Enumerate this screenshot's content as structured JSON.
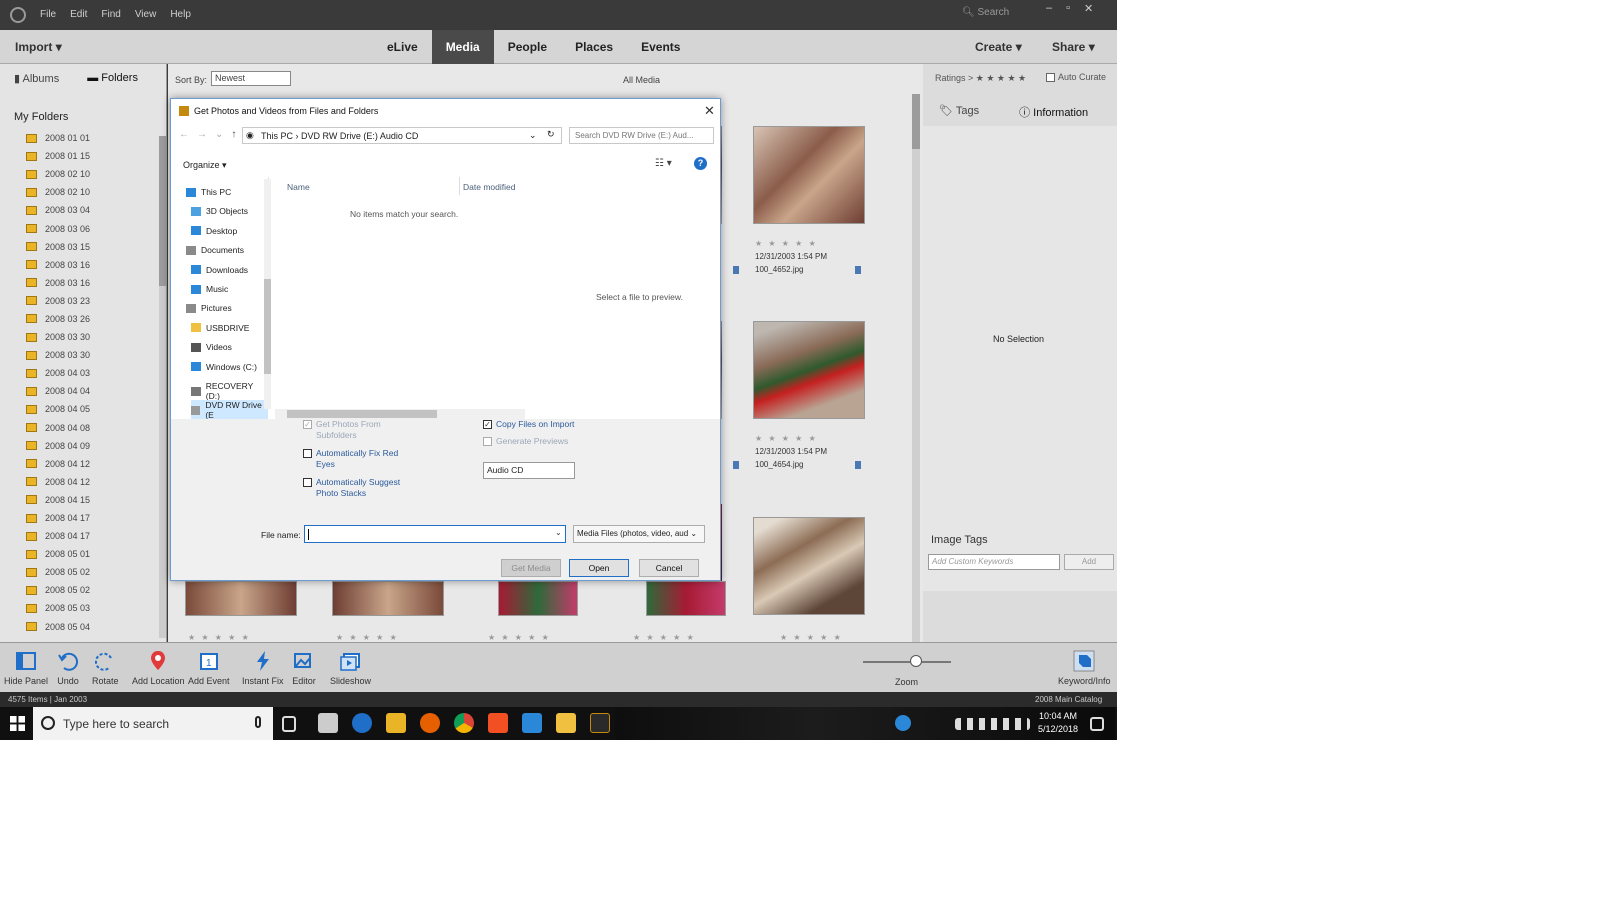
{
  "menubar": {
    "menus": [
      "File",
      "Edit",
      "Find",
      "View",
      "Help"
    ],
    "search_label": "Search",
    "window_controls": [
      "–",
      "▫",
      "✕"
    ]
  },
  "toolbar": {
    "import_label": "Import",
    "tabs": [
      "eLive",
      "Media",
      "People",
      "Places",
      "Events"
    ],
    "active_tab": "Media",
    "create_label": "Create",
    "share_label": "Share"
  },
  "leftpanel": {
    "tab_albums": "Albums",
    "tab_folders": "Folders",
    "my_folders_label": "My Folders",
    "folders": [
      "2008 01 01",
      "2008 01 15",
      "2008 02 10",
      "2008 02 10",
      "2008 03 04",
      "2008 03 06",
      "2008 03 15",
      "2008 03 16",
      "2008 03 16",
      "2008 03 23",
      "2008 03 26",
      "2008 03 30",
      "2008 03 30",
      "2008 04 03",
      "2008 04 04",
      "2008 04 05",
      "2008 04 08",
      "2008 04 09",
      "2008 04 12",
      "2008 04 12",
      "2008 04 15",
      "2008 04 17",
      "2008 04 17",
      "2008 05 01",
      "2008 05 02",
      "2008 05 02",
      "2008 05 03",
      "2008 05 04"
    ]
  },
  "media": {
    "sort_by_label": "Sort By:",
    "sort_value": "Newest",
    "all_media_label": "All Media",
    "photos": [
      {
        "date": "12/31/2003 1:54 PM",
        "filename": "100_4652.jpg",
        "stars": "★ ★ ★ ★ ★"
      },
      {
        "date": "12/31/2003 1:54 PM",
        "filename": "100_4654.jpg",
        "stars": "★ ★ ★ ★ ★"
      }
    ],
    "bottom_stars": "★ ★ ★ ★ ★"
  },
  "rightpanel": {
    "ratings_label": "Ratings",
    "ratings_stars": "★ ★ ★ ★ ★",
    "auto_curate_label": "Auto Curate",
    "tab_tags": "Tags",
    "tab_information": "Information",
    "no_selection": "No Selection",
    "image_tags_label": "Image Tags",
    "tags_placeholder": "Add Custom Keywords",
    "add_label": "Add"
  },
  "bottombar": {
    "items": [
      "Hide Panel",
      "Undo",
      "Rotate",
      "Add Location",
      "Add Event",
      "Instant Fix",
      "Editor",
      "Slideshow"
    ],
    "zoom_label": "Zoom",
    "keyword_info_label": "Keyword/Info"
  },
  "statusbar": {
    "left": "4575 Items | Jan 2003",
    "right": "2008 Main Catalog"
  },
  "taskbar": {
    "search_placeholder": "Type here to search",
    "time": "10:04 AM",
    "date": "5/12/2018"
  },
  "dialog": {
    "title": "Get Photos and Videos from Files and Folders",
    "address": "This PC  ›  DVD RW Drive (E:) Audio CD",
    "search_placeholder": "Search DVD RW Drive (E:) Aud...",
    "organize_label": "Organize ▾",
    "nav_items": [
      "This PC",
      "3D Objects",
      "Desktop",
      "Documents",
      "Downloads",
      "Music",
      "Pictures",
      "USBDRIVE",
      "Videos",
      "Windows (C:)",
      "RECOVERY (D:)",
      "DVD RW Drive (E"
    ],
    "col_name": "Name",
    "col_date": "Date modified",
    "no_items": "No items match your search.",
    "preview_text": "Select a file to preview.",
    "opt_subfolders": "Get Photos From Subfolders",
    "opt_red_eyes": "Automatically Fix Red Eyes",
    "opt_photo_stacks": "Automatically Suggest Photo Stacks",
    "opt_copy_files": "Copy Files on Import",
    "opt_generate_previews": "Generate Previews",
    "volume_name": "Audio CD",
    "file_name_label": "File name:",
    "file_type": "Media Files (photos, video, aud",
    "btn_get_media": "Get Media",
    "btn_open": "Open",
    "btn_cancel": "Cancel"
  },
  "colors": {
    "accent": "#1f6ec7",
    "folder_icon": "#e9b526",
    "toolbar_bg": "#d5d5d5",
    "active_tab_bg": "#4a4a4a"
  }
}
